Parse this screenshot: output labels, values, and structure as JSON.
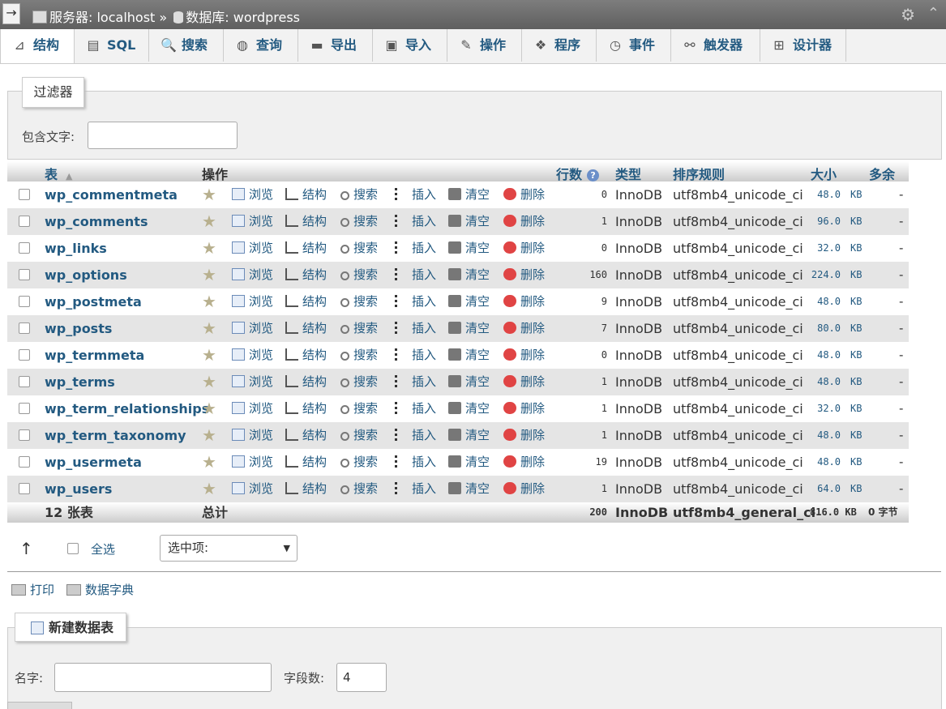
{
  "titlebar": {
    "arrow": "→",
    "server_label": "服务器: localhost",
    "separator": "»",
    "db_label": "数据库: wordpress",
    "gear": "⚙",
    "collapse": "⌃"
  },
  "tabs": [
    {
      "label": "结构",
      "icon": "structure-icon",
      "glyph": "⊿"
    },
    {
      "label": "SQL",
      "icon": "sql-icon",
      "glyph": "▤"
    },
    {
      "label": "搜索",
      "icon": "search-icon",
      "glyph": "🔍"
    },
    {
      "label": "查询",
      "icon": "query-icon",
      "glyph": "◍"
    },
    {
      "label": "导出",
      "icon": "export-icon",
      "glyph": "▬"
    },
    {
      "label": "导入",
      "icon": "import-icon",
      "glyph": "▣"
    },
    {
      "label": "操作",
      "icon": "wrench-icon",
      "glyph": "✎"
    },
    {
      "label": "程序",
      "icon": "routines-icon",
      "glyph": "❖"
    },
    {
      "label": "事件",
      "icon": "clock-icon",
      "glyph": "◷"
    },
    {
      "label": "触发器",
      "icon": "trigger-icon",
      "glyph": "⚯"
    },
    {
      "label": "设计器",
      "icon": "designer-icon",
      "glyph": "⊞"
    }
  ],
  "filter": {
    "legend": "过滤器",
    "label": "包含文字:",
    "value": ""
  },
  "table_headers": {
    "table": "表",
    "sort": "▲",
    "action": "操作",
    "rows": "行数",
    "help": "?",
    "type": "类型",
    "collation": "排序规则",
    "size": "大小",
    "overhead": "多余"
  },
  "actions": {
    "favorite": "★",
    "browse": "浏览",
    "structure": "结构",
    "search": "搜索",
    "insert": "插入",
    "empty": "清空",
    "drop": "删除"
  },
  "tables": [
    {
      "name": "wp_commentmeta",
      "rows": "0",
      "engine": "InnoDB",
      "collation": "utf8mb4_unicode_ci",
      "size": "48.0",
      "unit": "KB",
      "overhead": "-"
    },
    {
      "name": "wp_comments",
      "rows": "1",
      "engine": "InnoDB",
      "collation": "utf8mb4_unicode_ci",
      "size": "96.0",
      "unit": "KB",
      "overhead": "-"
    },
    {
      "name": "wp_links",
      "rows": "0",
      "engine": "InnoDB",
      "collation": "utf8mb4_unicode_ci",
      "size": "32.0",
      "unit": "KB",
      "overhead": "-"
    },
    {
      "name": "wp_options",
      "rows": "160",
      "engine": "InnoDB",
      "collation": "utf8mb4_unicode_ci",
      "size": "224.0",
      "unit": "KB",
      "overhead": "-"
    },
    {
      "name": "wp_postmeta",
      "rows": "9",
      "engine": "InnoDB",
      "collation": "utf8mb4_unicode_ci",
      "size": "48.0",
      "unit": "KB",
      "overhead": "-"
    },
    {
      "name": "wp_posts",
      "rows": "7",
      "engine": "InnoDB",
      "collation": "utf8mb4_unicode_ci",
      "size": "80.0",
      "unit": "KB",
      "overhead": "-"
    },
    {
      "name": "wp_termmeta",
      "rows": "0",
      "engine": "InnoDB",
      "collation": "utf8mb4_unicode_ci",
      "size": "48.0",
      "unit": "KB",
      "overhead": "-"
    },
    {
      "name": "wp_terms",
      "rows": "1",
      "engine": "InnoDB",
      "collation": "utf8mb4_unicode_ci",
      "size": "48.0",
      "unit": "KB",
      "overhead": "-"
    },
    {
      "name": "wp_term_relationships",
      "rows": "1",
      "engine": "InnoDB",
      "collation": "utf8mb4_unicode_ci",
      "size": "32.0",
      "unit": "KB",
      "overhead": "-"
    },
    {
      "name": "wp_term_taxonomy",
      "rows": "1",
      "engine": "InnoDB",
      "collation": "utf8mb4_unicode_ci",
      "size": "48.0",
      "unit": "KB",
      "overhead": "-"
    },
    {
      "name": "wp_usermeta",
      "rows": "19",
      "engine": "InnoDB",
      "collation": "utf8mb4_unicode_ci",
      "size": "48.0",
      "unit": "KB",
      "overhead": "-"
    },
    {
      "name": "wp_users",
      "rows": "1",
      "engine": "InnoDB",
      "collation": "utf8mb4_unicode_ci",
      "size": "64.0",
      "unit": "KB",
      "overhead": "-"
    }
  ],
  "summary": {
    "count": "12 张表",
    "total_label": "总计",
    "rows": "200",
    "engine": "InnoDB",
    "collation": "utf8mb4_general_ci",
    "size": "816.0 KB",
    "overhead": "0 字节"
  },
  "footer": {
    "arrow": "↑",
    "check_all": "全选",
    "with_selected": "选中项:",
    "caret": "▼",
    "print": "打印",
    "data_dict": "数据字典"
  },
  "create_table": {
    "legend": "新建数据表",
    "name_label": "名字:",
    "name_value": "",
    "fields_label": "字段数:",
    "fields_value": "4"
  }
}
